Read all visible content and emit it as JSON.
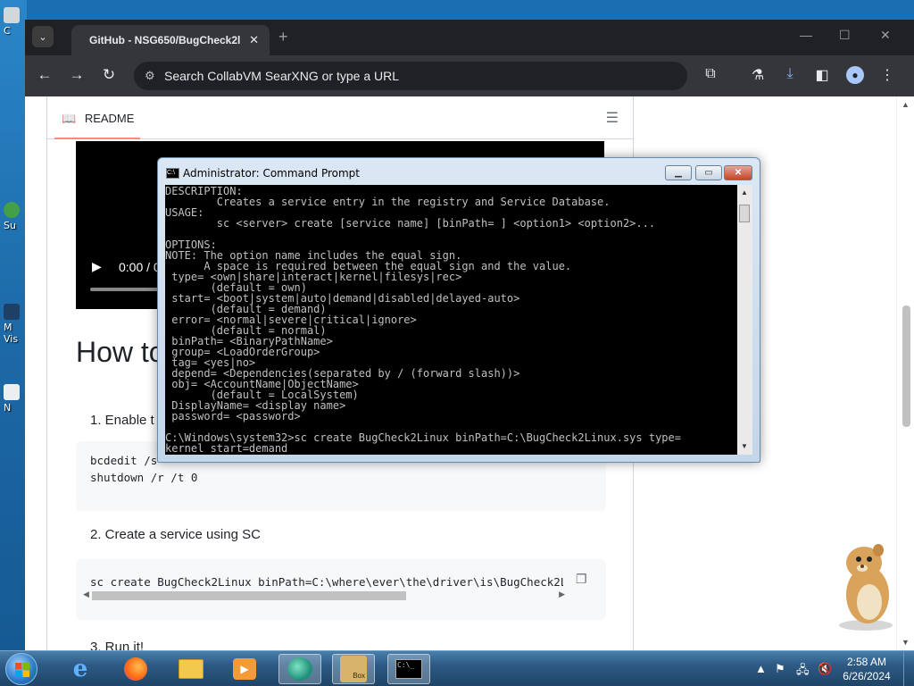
{
  "browser": {
    "tab_title": "GitHub - NSG650/BugCheck2l",
    "tab_close": "✕",
    "new_tab": "+",
    "address_placeholder": "Search CollabVM SearXNG or type a URL",
    "window_controls": [
      "—",
      "☐",
      "✕"
    ]
  },
  "readme": {
    "tab_label": "README",
    "video_time": "0:00 / 0",
    "heading": "How to",
    "step1": "1. Enable t",
    "code1_line1": "bcdedit /s",
    "code1_line2": "shutdown /r /t 0",
    "step2": "2. Create a service using SC",
    "code2": "sc create BugCheck2Linux binPath=C:\\where\\ever\\the\\driver\\is\\BugCheck2L",
    "step3": "3. Run it!"
  },
  "cmd": {
    "title": "Administrator: Command Prompt",
    "lines": [
      "DESCRIPTION:",
      "        Creates a service entry in the registry and Service Database.",
      "USAGE:",
      "        sc <server> create [service name] [binPath= ] <option1> <option2>...",
      "",
      "OPTIONS:",
      "NOTE: The option name includes the equal sign.",
      "      A space is required between the equal sign and the value.",
      " type= <own|share|interact|kernel|filesys|rec>",
      "       (default = own)",
      " start= <boot|system|auto|demand|disabled|delayed-auto>",
      "       (default = demand)",
      " error= <normal|severe|critical|ignore>",
      "       (default = normal)",
      " binPath= <BinaryPathName>",
      " group= <LoadOrderGroup>",
      " tag= <yes|no>",
      " depend= <Dependencies(separated by / (forward slash))>",
      " obj= <AccountName|ObjectName>",
      "       (default = LocalSystem)",
      " DisplayName= <display name>",
      " password= <password>",
      "",
      "C:\\Windows\\system32>sc create BugCheck2Linux binPath=C:\\BugCheck2Linux.sys type=",
      "kernel start=demand"
    ]
  },
  "taskbar": {
    "time": "2:58 AM",
    "date": "6/26/2024",
    "apps": [
      "internet-explorer",
      "firefox",
      "file-explorer",
      "media-player",
      "collabvm",
      "bonzi-box",
      "command-prompt"
    ],
    "box_label": "Box"
  },
  "desktop": {
    "labels": [
      "C",
      "Su",
      "M",
      "Vis",
      "N"
    ]
  }
}
